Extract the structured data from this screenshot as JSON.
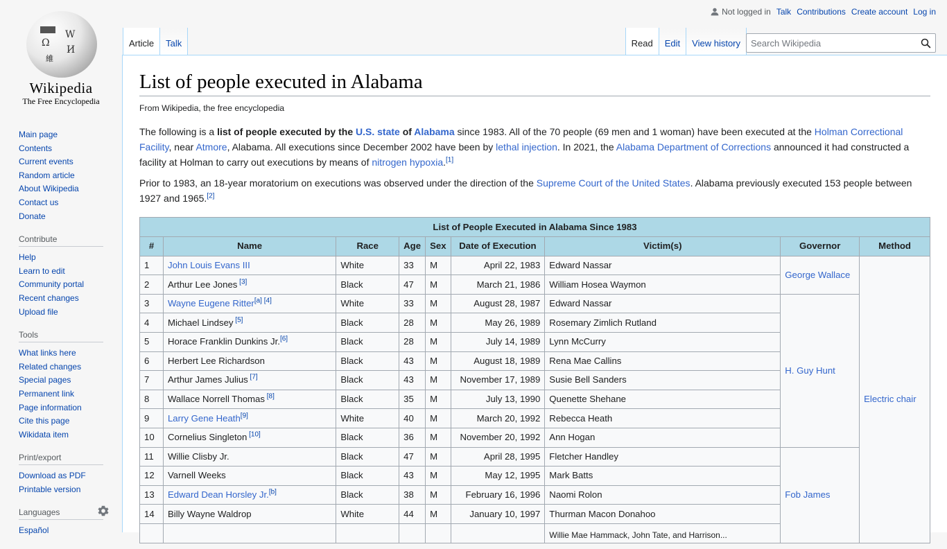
{
  "logo": {
    "wordmark": "Wikipedia",
    "tagline": "The Free Encyclopedia"
  },
  "personal": {
    "not_logged_in": "Not logged in",
    "talk": "Talk",
    "contributions": "Contributions",
    "create_account": "Create account",
    "log_in": "Log in"
  },
  "tabs": {
    "article": "Article",
    "talk": "Talk",
    "read": "Read",
    "edit": "Edit",
    "view_history": "View history"
  },
  "search": {
    "placeholder": "Search Wikipedia",
    "value": ""
  },
  "sidebar": {
    "navigation": [
      "Main page",
      "Contents",
      "Current events",
      "Random article",
      "About Wikipedia",
      "Contact us",
      "Donate"
    ],
    "contribute": {
      "heading": "Contribute",
      "items": [
        "Help",
        "Learn to edit",
        "Community portal",
        "Recent changes",
        "Upload file"
      ]
    },
    "tools": {
      "heading": "Tools",
      "items": [
        "What links here",
        "Related changes",
        "Special pages",
        "Permanent link",
        "Page information",
        "Cite this page",
        "Wikidata item"
      ]
    },
    "print": {
      "heading": "Print/export",
      "items": [
        "Download as PDF",
        "Printable version"
      ]
    },
    "languages": {
      "heading": "Languages",
      "items": [
        "Español"
      ]
    }
  },
  "article": {
    "title": "List of people executed in Alabama",
    "site_sub": "From Wikipedia, the free encyclopedia",
    "p1": {
      "t1": "The following is a ",
      "b1": "list of people executed by the ",
      "l_us_state": "U.S. state",
      "b2": " of ",
      "l_alabama": "Alabama",
      "t2": " since 1983. All of the 70 people (69 men and 1 woman) have been executed at the ",
      "l_holman": "Holman Correctional Facility",
      "t3": ", near ",
      "l_atmore": "Atmore",
      "t4": ", Alabama. All executions since December 2002 have been by ",
      "l_lethal": "lethal injection",
      "t5": ". In 2021, the ",
      "l_adoc": "Alabama Department of Corrections",
      "t6": " announced it had constructed a facility at Holman to carry out executions by means of ",
      "l_nitrogen": "nitrogen hypoxia",
      "t7": ".",
      "ref": "[1]"
    },
    "p2": {
      "t1": "Prior to 1983, an 18-year moratorium on executions was observed under the direction of the ",
      "l_scotus": "Supreme Court of the United States",
      "t2": ". Alabama previously executed 153 people between 1927 and 1965.",
      "ref": "[2]"
    }
  },
  "table": {
    "caption": "List of People Executed in Alabama Since 1983",
    "headers": [
      "#",
      "Name",
      "Race",
      "Age",
      "Sex",
      "Date of Execution",
      "Victim(s)",
      "Governor",
      "Method"
    ],
    "rows": [
      {
        "num": "1",
        "name": "John Louis Evans III",
        "name_link": true,
        "refs": "",
        "race": "White",
        "age": "33",
        "sex": "M",
        "date": "April 22, 1983",
        "victim": "Edward Nassar"
      },
      {
        "num": "2",
        "name": "Arthur Lee Jones",
        "name_link": false,
        "refs": " [3]",
        "race": "Black",
        "age": "47",
        "sex": "M",
        "date": "March 21, 1986",
        "victim": "William Hosea Waymon"
      },
      {
        "num": "3",
        "name": "Wayne Eugene Ritter",
        "name_link": true,
        "refs": "[a] [4]",
        "race": "White",
        "age": "33",
        "sex": "M",
        "date": "August 28, 1987",
        "victim": "Edward Nassar"
      },
      {
        "num": "4",
        "name": "Michael Lindsey",
        "name_link": false,
        "refs": " [5]",
        "race": "Black",
        "age": "28",
        "sex": "M",
        "date": "May 26, 1989",
        "victim": "Rosemary Zimlich Rutland"
      },
      {
        "num": "5",
        "name": "Horace Franklin Dunkins Jr.",
        "name_link": false,
        "refs": "[6]",
        "race": "Black",
        "age": "28",
        "sex": "M",
        "date": "July 14, 1989",
        "victim": "Lynn McCurry"
      },
      {
        "num": "6",
        "name": "Herbert Lee Richardson",
        "name_link": false,
        "refs": "",
        "race": "Black",
        "age": "43",
        "sex": "M",
        "date": "August 18, 1989",
        "victim": "Rena Mae Callins"
      },
      {
        "num": "7",
        "name": "Arthur James Julius",
        "name_link": false,
        "refs": " [7]",
        "race": "Black",
        "age": "43",
        "sex": "M",
        "date": "November 17, 1989",
        "victim": "Susie Bell Sanders"
      },
      {
        "num": "8",
        "name": "Wallace Norrell Thomas",
        "name_link": false,
        "refs": " [8]",
        "race": "Black",
        "age": "35",
        "sex": "M",
        "date": "July 13, 1990",
        "victim": "Quenette Shehane"
      },
      {
        "num": "9",
        "name": "Larry Gene Heath",
        "name_link": true,
        "refs": "[9]",
        "race": "White",
        "age": "40",
        "sex": "M",
        "date": "March 20, 1992",
        "victim": "Rebecca Heath"
      },
      {
        "num": "10",
        "name": "Cornelius Singleton",
        "name_link": false,
        "refs": " [10]",
        "race": "Black",
        "age": "36",
        "sex": "M",
        "date": "November 20, 1992",
        "victim": "Ann Hogan"
      },
      {
        "num": "11",
        "name": "Willie Clisby Jr.",
        "name_link": false,
        "refs": "",
        "race": "Black",
        "age": "47",
        "sex": "M",
        "date": "April 28, 1995",
        "victim": "Fletcher Handley"
      },
      {
        "num": "12",
        "name": "Varnell Weeks",
        "name_link": false,
        "refs": "",
        "race": "Black",
        "age": "43",
        "sex": "M",
        "date": "May 12, 1995",
        "victim": "Mark Batts"
      },
      {
        "num": "13",
        "name": "Edward Dean Horsley Jr.",
        "name_link": true,
        "refs": "[b]",
        "race": "Black",
        "age": "38",
        "sex": "M",
        "date": "February 16, 1996",
        "victim": "Naomi Rolon"
      },
      {
        "num": "14",
        "name": "Billy Wayne Waldrop",
        "name_link": false,
        "refs": "",
        "race": "White",
        "age": "44",
        "sex": "M",
        "date": "January 10, 1997",
        "victim": "Thurman Macon Donahoo"
      },
      {
        "num": "",
        "name": "",
        "name_link": false,
        "refs": "",
        "race": "",
        "age": "",
        "sex": "",
        "date": "",
        "victim": "Willie Mae Hammack, John Tate, and Harrison..."
      }
    ],
    "governors": [
      {
        "name": "George Wallace",
        "rows": 2
      },
      {
        "name": "H. Guy Hunt",
        "rows": 8
      },
      {
        "name": "Fob James",
        "rows": 5
      }
    ],
    "methods": [
      {
        "name": "Electric chair",
        "rows": 15
      }
    ]
  }
}
